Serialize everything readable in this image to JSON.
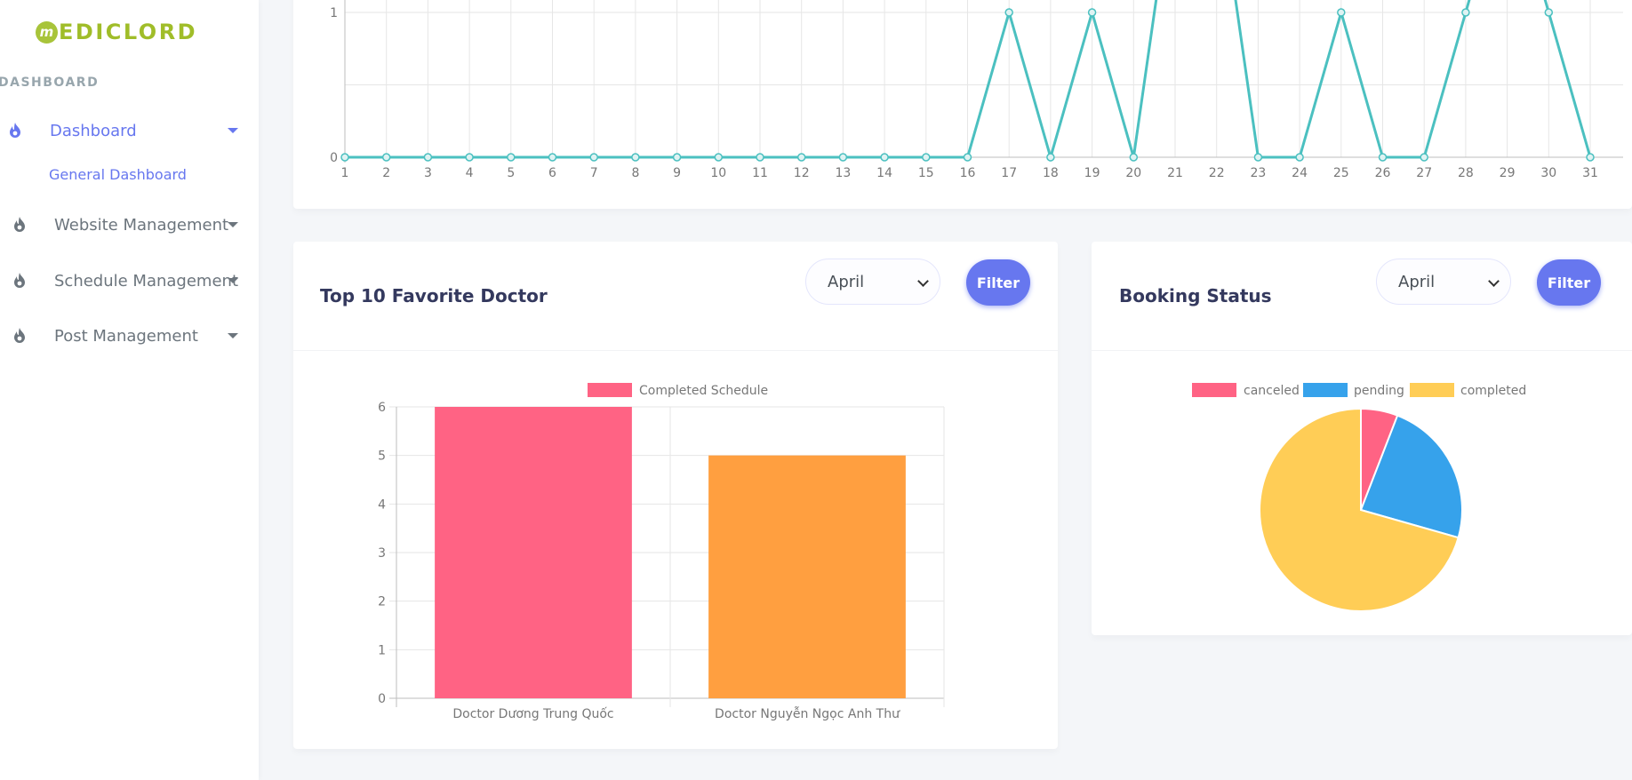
{
  "brand": {
    "logo_letter": "m",
    "name": "EDICLORD"
  },
  "sidebar": {
    "section_label": "DASHBOARD",
    "items": [
      {
        "label": "Dashboard",
        "active": true
      },
      {
        "label": "Website Management",
        "active": false
      },
      {
        "label": "Schedule Management",
        "active": false
      },
      {
        "label": "Post Management",
        "active": false
      }
    ],
    "submenu": {
      "label": "General Dashboard"
    }
  },
  "colors": {
    "primary": "#6777ef",
    "brand": "#a0bd29",
    "line": "#4bc0c0",
    "bar1": "#ff6384",
    "bar2": "#ff9f40",
    "pie_canceled": "#ff6384",
    "pie_pending": "#36a2eb",
    "pie_completed": "#ffcd56"
  },
  "favorite_doctor_card": {
    "title": "Top 10 Favorite Doctor",
    "select_value": "April",
    "filter_label": "Filter"
  },
  "booking_status_card": {
    "title": "Booking Status",
    "select_value": "April",
    "filter_label": "Filter"
  },
  "chart_data": [
    {
      "type": "line",
      "x": [
        1,
        2,
        3,
        4,
        5,
        6,
        7,
        8,
        9,
        10,
        11,
        12,
        13,
        14,
        15,
        16,
        17,
        18,
        19,
        20,
        21,
        22,
        23,
        24,
        25,
        26,
        27,
        28,
        29,
        30,
        31
      ],
      "series": [
        {
          "values": [
            0,
            0,
            0,
            0,
            0,
            0,
            0,
            0,
            0,
            0,
            0,
            0,
            0,
            0,
            0,
            0,
            1,
            0,
            1,
            0,
            2,
            2,
            0,
            0,
            1,
            0,
            0,
            1,
            2,
            1,
            0
          ]
        }
      ],
      "y_ticks": [
        0,
        1
      ],
      "grid": true
    },
    {
      "type": "bar",
      "categories": [
        "Doctor Dương Trung Quốc",
        "Doctor Nguyễn Ngọc Anh Thư"
      ],
      "series": [
        {
          "name": "Completed Schedule",
          "values": [
            6,
            5
          ]
        }
      ],
      "bar_colors": [
        "#ff6384",
        "#ff9f40"
      ],
      "ylim": [
        0,
        6
      ],
      "y_ticks": [
        0,
        1,
        2,
        3,
        4,
        5,
        6
      ],
      "legend": "top",
      "grid": true
    },
    {
      "type": "pie",
      "labels": [
        "canceled",
        "pending",
        "completed"
      ],
      "values": [
        1,
        4,
        12
      ],
      "colors": [
        "#ff6384",
        "#36a2eb",
        "#ffcd56"
      ],
      "legend": "top"
    }
  ]
}
